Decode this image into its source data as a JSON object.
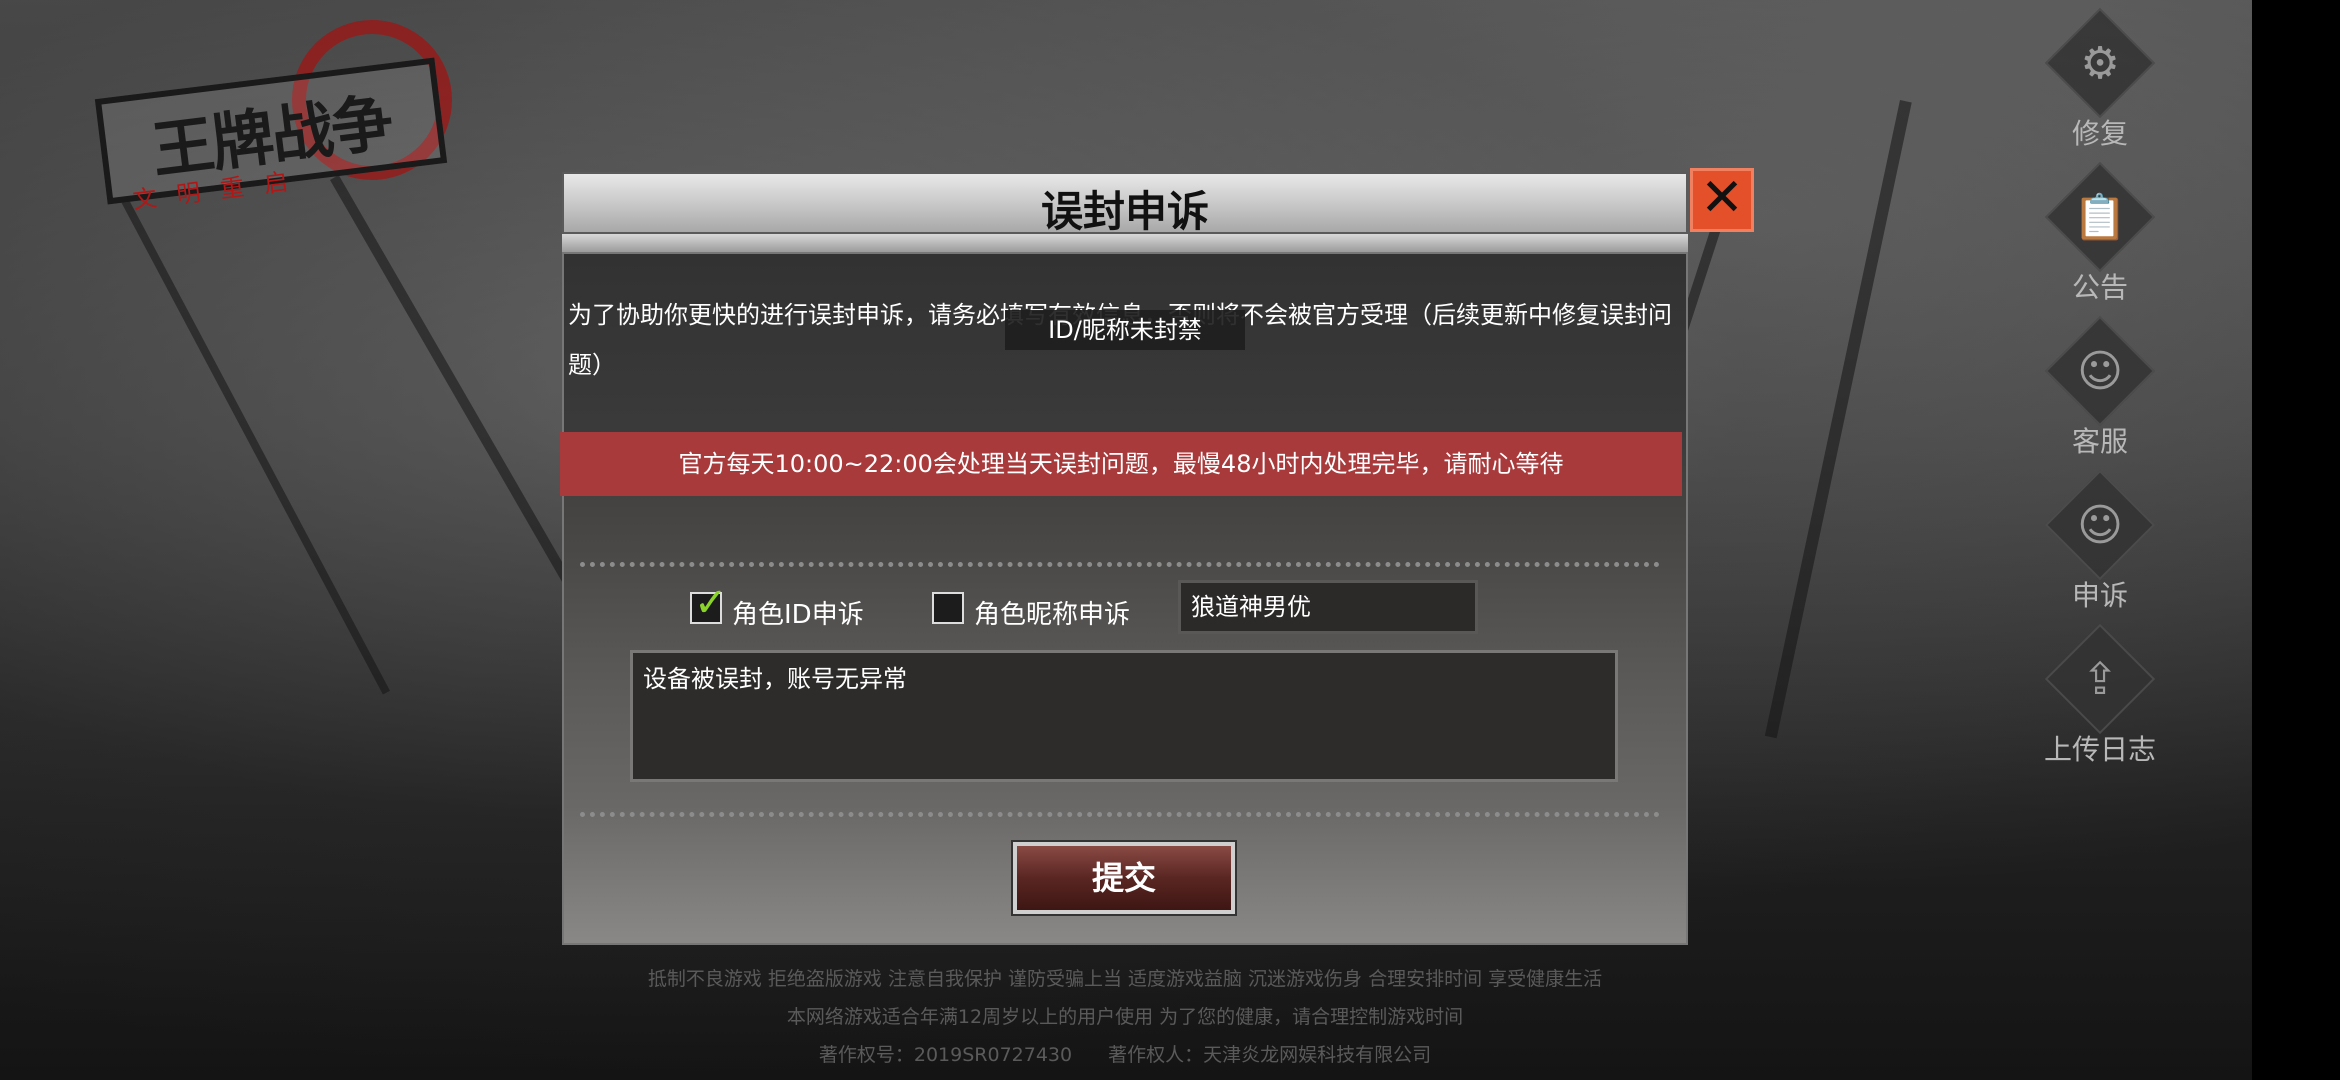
{
  "logo": {
    "title": "王牌战争",
    "subtitle": "文明重启"
  },
  "sidebar": {
    "items": [
      {
        "label": "修复",
        "icon": "gear-icon"
      },
      {
        "label": "公告",
        "icon": "notice-icon"
      },
      {
        "label": "客服",
        "icon": "headset-icon"
      },
      {
        "label": "申诉",
        "icon": "headset-icon"
      },
      {
        "label": "上传日志",
        "icon": "upload-icon"
      }
    ]
  },
  "dialog": {
    "title": "误封申诉",
    "notice": "为了协助你更快的进行误封申诉，请务必填写有效信息，否则将不会被官方受理（后续更新中修复误封问题）",
    "tooltip": "ID/昵称未封禁",
    "banner": "官方每天10:00~22:00会处理当天误封问题，最慢48小时内处理完毕，请耐心等待",
    "option_id_label": "角色ID申诉",
    "option_id_checked": true,
    "option_nick_label": "角色昵称申诉",
    "option_nick_checked": false,
    "name_value": "狼道神男优",
    "reason_value": "设备被误封，账号无异常",
    "submit_label": "提交"
  },
  "footer": {
    "line1": "抵制不良游戏 拒绝盗版游戏 注意自我保护 谨防受骗上当 适度游戏益脑 沉迷游戏伤身 合理安排时间 享受健康生活",
    "line2": "本网络游戏适合年满12周岁以上的用户使用  为了您的健康，请合理控制游戏时间",
    "copyright_no": "著作权号：2019SR0727430",
    "copyright_owner": "著作权人：天津炎龙网娱科技有限公司"
  },
  "colors": {
    "banner": "#a83a3c",
    "close": "#e3502a",
    "check": "#8ad42a"
  }
}
